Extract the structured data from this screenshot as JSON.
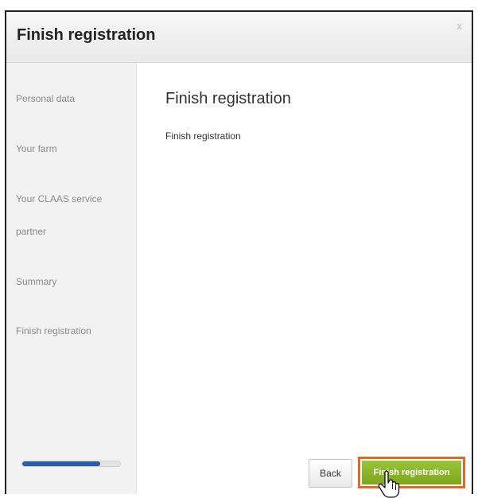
{
  "dialog": {
    "title": "Finish registration",
    "close_label": "x"
  },
  "sidebar": {
    "steps": [
      {
        "label": "Personal data"
      },
      {
        "label": "Your farm"
      },
      {
        "label": "Your CLAAS service"
      },
      {
        "label": "partner"
      },
      {
        "label": "Summary"
      },
      {
        "label": "Finish registration"
      }
    ],
    "progress_percent": 80
  },
  "main": {
    "heading": "Finish registration",
    "text": "Finish registration"
  },
  "footer": {
    "back_label": "Back",
    "finish_label": "Finish registration"
  },
  "colors": {
    "progress": "#2b5ea4",
    "finish_button": "#8db52a",
    "highlight_border": "#e06a25"
  },
  "icons": {
    "close": "close-icon",
    "cursor": "hand-cursor-icon"
  }
}
